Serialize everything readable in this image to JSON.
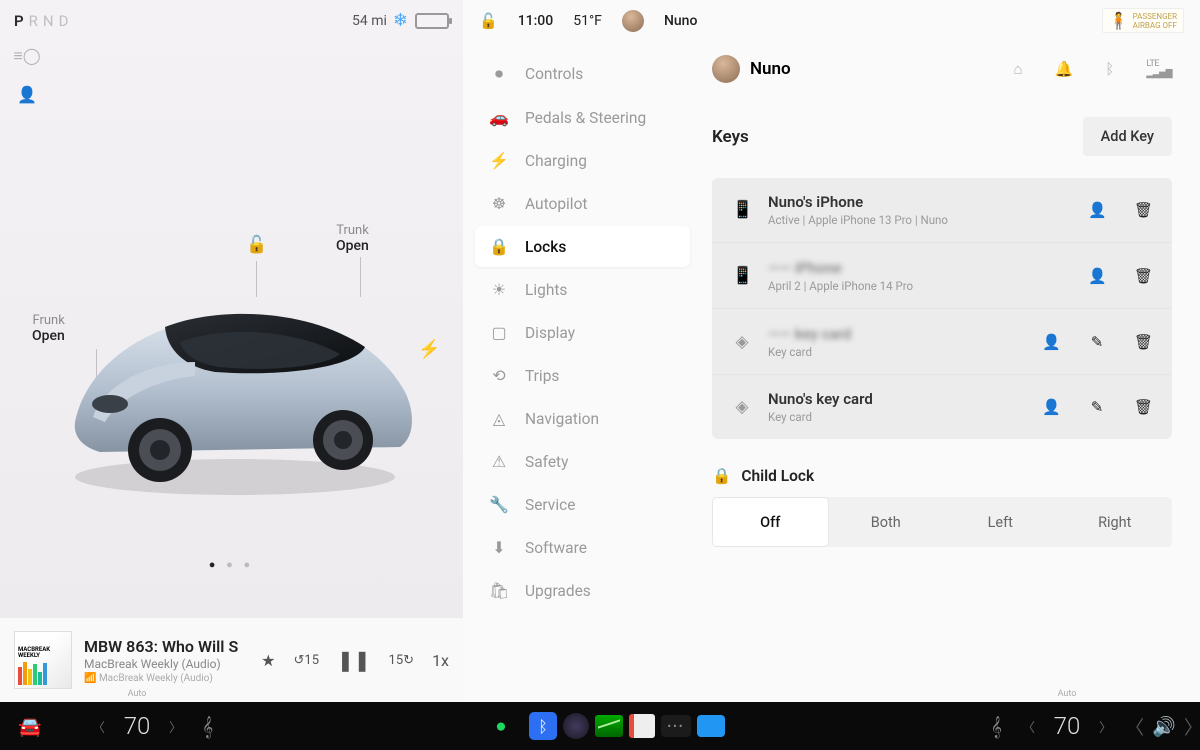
{
  "left": {
    "gears": [
      "P",
      "R",
      "N",
      "D"
    ],
    "gear_active": "P",
    "range": "54 mi",
    "frunk_label": "Frunk",
    "frunk_state": "Open",
    "trunk_label": "Trunk",
    "trunk_state": "Open"
  },
  "media": {
    "title": "MBW 863: Who Will S",
    "subtitle": "MacBreak Weekly (Audio)",
    "source": "MacBreak Weekly (Audio)",
    "speed": "1x",
    "art_label": "MACBREAK WEEKLY"
  },
  "topbar": {
    "time": "11:00",
    "temp": "51°F",
    "profile": "Nuno",
    "airbag_line1": "PASSENGER",
    "airbag_line2": "AIRBAG OFF"
  },
  "sidebar": [
    {
      "icon": "⏺",
      "label": "Controls"
    },
    {
      "icon": "🚗",
      "label": "Pedals & Steering"
    },
    {
      "icon": "⚡",
      "label": "Charging"
    },
    {
      "icon": "☸",
      "label": "Autopilot"
    },
    {
      "icon": "🔒",
      "label": "Locks",
      "active": true
    },
    {
      "icon": "☀",
      "label": "Lights"
    },
    {
      "icon": "▢",
      "label": "Display"
    },
    {
      "icon": "⟲",
      "label": "Trips"
    },
    {
      "icon": "◬",
      "label": "Navigation"
    },
    {
      "icon": "⚠",
      "label": "Safety"
    },
    {
      "icon": "🔧",
      "label": "Service"
    },
    {
      "icon": "⬇",
      "label": "Software"
    },
    {
      "icon": "🛍",
      "label": "Upgrades"
    }
  ],
  "content": {
    "profile": "Nuno",
    "section": "Keys",
    "add_key": "Add Key",
    "keys": [
      {
        "icon": "📱",
        "name": "Nuno's iPhone",
        "sub": "Active | Apple iPhone 13 Pro | Nuno",
        "edit": false
      },
      {
        "icon": "📱",
        "name": "—— iPhone",
        "sub": "April 2 | Apple iPhone 14 Pro",
        "edit": false,
        "blurred": true
      },
      {
        "icon": "◈",
        "name": "—— key card",
        "sub": "Key card",
        "edit": true,
        "blurred": true
      },
      {
        "icon": "◈",
        "name": "Nuno's key card",
        "sub": "Key card",
        "edit": true
      }
    ],
    "child_lock": {
      "label": "Child Lock",
      "options": [
        "Off",
        "Both",
        "Left",
        "Right"
      ],
      "selected": "Off"
    },
    "lte": "LTE"
  },
  "bottom": {
    "temp_left": "70",
    "temp_right": "70",
    "auto": "Auto"
  }
}
